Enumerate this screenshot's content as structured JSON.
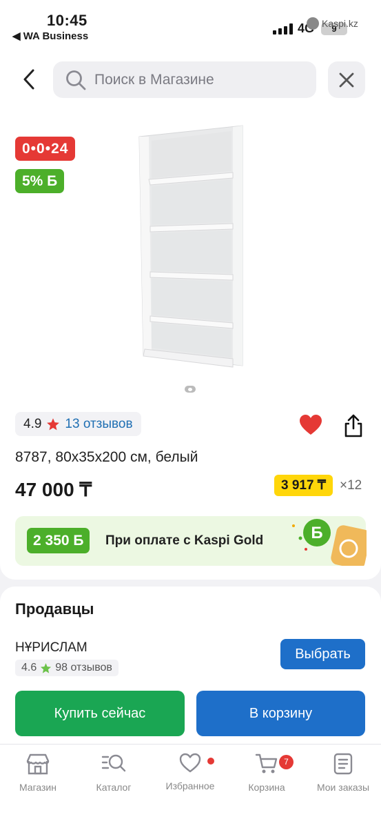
{
  "status": {
    "time": "10:45",
    "back_app": "◀ WA Business",
    "network": "4G",
    "battery": "9",
    "watermark": "Kaspi.kz"
  },
  "search": {
    "placeholder": "Поиск в Магазине"
  },
  "product": {
    "timer_badge": "0•0•24",
    "bonus_badge": "5% Б",
    "rating": "4.9",
    "reviews": "13 отзывов",
    "title": "8787, 80x35x200 см, белый",
    "price": "47 000 ₸",
    "installment": "3 917 ₸",
    "installment_mult": "×12",
    "promo_bonus": "2 350 Б",
    "promo_text": "При оплате с Kaspi Gold"
  },
  "sellers": {
    "title": "Продавцы",
    "seller_name": "НҰРИСЛАМ",
    "seller_rating": "4.6",
    "seller_reviews": "98 отзывов",
    "choose_label": "Выбрать",
    "buy_now_label": "Купить сейчас",
    "to_cart_label": "В корзину"
  },
  "tabbar": {
    "items": [
      {
        "label": "Магазин"
      },
      {
        "label": "Каталог"
      },
      {
        "label": "Избранное"
      },
      {
        "label": "Корзина",
        "badge": "7"
      },
      {
        "label": "Мои заказы"
      }
    ]
  },
  "colors": {
    "kaspi_red": "#e53935",
    "kaspi_green": "#4caf2a",
    "buy_green": "#1aa653",
    "kaspi_blue": "#1e6fc9",
    "installment_yellow": "#ffd60a"
  }
}
